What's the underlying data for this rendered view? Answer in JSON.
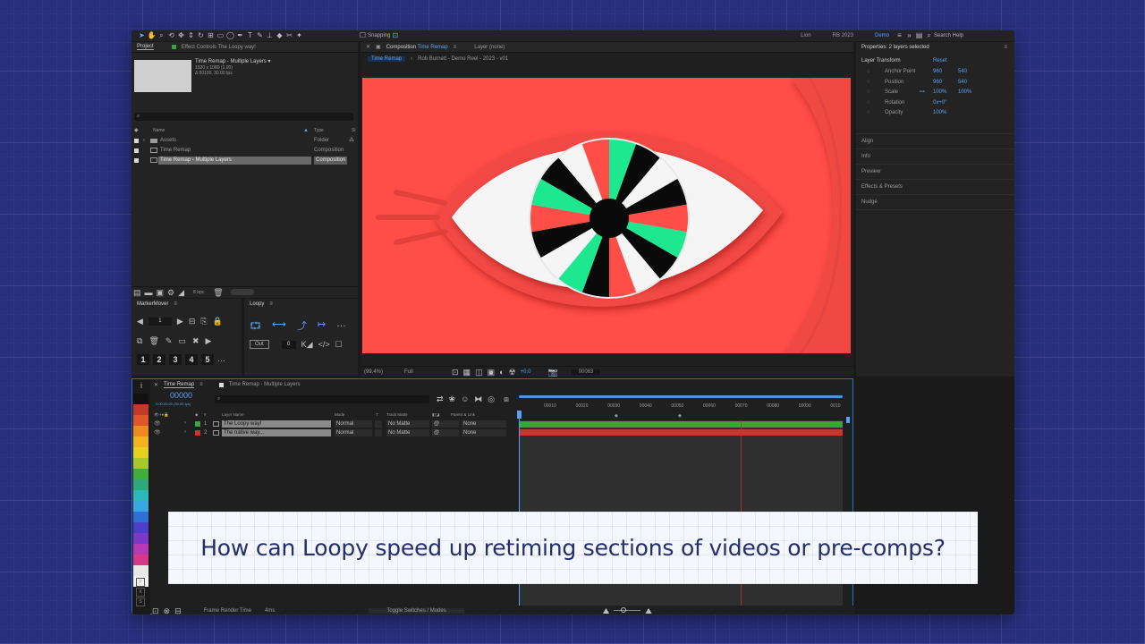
{
  "toolbar": {
    "snapping": "Snapping",
    "workspaces": [
      "Lion",
      "RB 2023",
      "Demo"
    ],
    "search": "Search Help"
  },
  "project": {
    "tab": "Project",
    "effect_controls": "Effect Controls The Loopy way!",
    "item_name": "Time Remap - Multiple Layers ▾",
    "item_info1": "1920 x 1080 (1.00)",
    "item_info2": "Δ 00100, 30.00 fps",
    "col_name": "Name",
    "col_type": "Type",
    "col_size": "Si",
    "items": [
      {
        "name": "Assets",
        "type": "Folder"
      },
      {
        "name": "Time Remap",
        "type": "Composition"
      },
      {
        "name": "Time Remap - Multiple Layers",
        "type": "Composition"
      }
    ],
    "bpc": "8 bpc"
  },
  "markermover": {
    "title": "MarkerMover",
    "value": "1"
  },
  "loopy": {
    "title": "Loopy",
    "out_label": "Out",
    "value": "0"
  },
  "viewer": {
    "comp_tab": "Composition",
    "comp_name": "Time Remap",
    "layer_tab": "Layer (none)",
    "flow": "Time Remap",
    "breadcrumb": "Rob Burnett - Demo Reel - 2023 - v01",
    "zoom": "(99.4%)",
    "quality": "Full",
    "exposure": "+0.0",
    "timecode": "00063"
  },
  "properties": {
    "title": "Properties: 2 layers selected",
    "section": "Layer Transform",
    "reset": "Reset",
    "rows": [
      {
        "label": "Anchor Point",
        "v1": "960",
        "v2": "540"
      },
      {
        "label": "Position",
        "v1": "960",
        "v2": "540"
      },
      {
        "label": "Scale",
        "v1": "100%",
        "v2": "100%"
      },
      {
        "label": "Rotation",
        "v1": "0x+0°",
        "v2": ""
      },
      {
        "label": "Opacity",
        "v1": "100%",
        "v2": ""
      }
    ],
    "panels": [
      "Align",
      "Info",
      "Preview",
      "Effects & Presets",
      "Nudge"
    ]
  },
  "timeline": {
    "tab": "Time Remap",
    "tab2": "Time Remap - Multiple Layers",
    "timecode": "00000",
    "timecode_sub": "0:00:00:00 (30.00 fps)",
    "cols": {
      "layer_name": "Layer Name",
      "mode": "Mode",
      "t": "T",
      "track_matte": "Track Matte",
      "parent": "Parent & Link"
    },
    "layers": [
      {
        "num": "1",
        "name": "The Loopy way!",
        "mode": "Normal",
        "matte": "No Matte",
        "parent": "None",
        "color": "#3aa53a"
      },
      {
        "num": "2",
        "name": "The native way...",
        "mode": "Normal",
        "matte": "No Matte",
        "parent": "None",
        "color": "#c8382e"
      }
    ],
    "ticks": [
      "00010",
      "00020",
      "00030",
      "00040",
      "00050",
      "00060",
      "00070",
      "00080",
      "00090",
      "0010"
    ],
    "footer_render": "Frame Render Time",
    "footer_render_val": "4ms",
    "footer_toggle": "Toggle Switches / Modes",
    "swatch_letters": [
      "P",
      "X",
      "S"
    ]
  },
  "colors": {
    "palette": [
      "#e8e8e8",
      "#c33a2a",
      "#e0552a",
      "#ee8a22",
      "#f2b41e",
      "#e6d020",
      "#a8c82a",
      "#3fae3a",
      "#2fa87a",
      "#2ab8b8",
      "#3aa8e0",
      "#2f6fd8",
      "#4a3fc8",
      "#7a3ac8",
      "#b63ab4",
      "#d8388a",
      "#e8e8e8",
      "#f2f2f2"
    ],
    "art_bg": "#ff4d47"
  },
  "caption": "How can Loopy speed up retiming sections of videos or pre-comps?"
}
